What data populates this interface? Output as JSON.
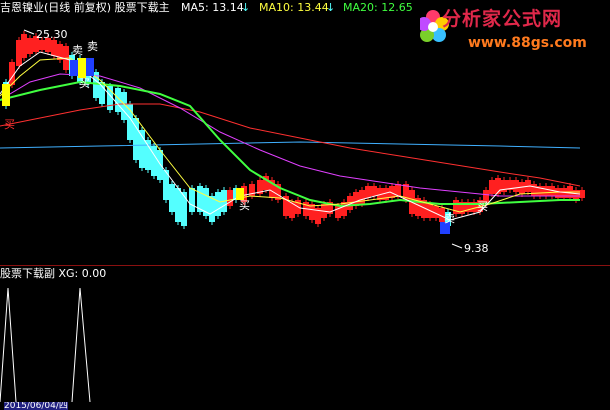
{
  "header": {
    "title": "吉恩镍业(日线 前复权) 股票下载主",
    "ma5_label": "MA5: 13.14",
    "ma10_label": "MA10: 13.44",
    "ma20_label": "MA20: 12.65",
    "arrow": "↓"
  },
  "logo": {
    "text": "分析家公式网",
    "url": "www.88gs.com"
  },
  "annotations": {
    "high_price": "25.30",
    "low_price": "9.38",
    "buy": "买",
    "sell": "卖"
  },
  "sub_panel": {
    "title": "股票下载副 XG: 0.00"
  },
  "date_bar": {
    "date": "2015/06/04/四"
  },
  "colors": {
    "background": "#000000",
    "up_candle": "#ff2020",
    "down_candle": "#54ffff",
    "ma5": "#ffffff",
    "ma10": "#ffff40",
    "ma20": "#e040ff",
    "green_line": "#40ff40",
    "red_line": "#ff3030",
    "blue_line": "#40b0ff",
    "signal_yellow": "#ffff00",
    "signal_blue": "#2040ff"
  }
}
